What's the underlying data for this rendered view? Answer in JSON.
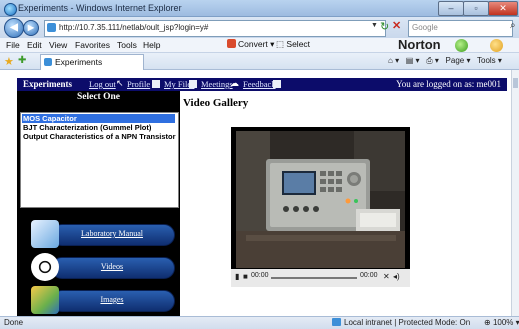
{
  "window": {
    "title": "Experiments - Windows Internet Explorer",
    "min": "–",
    "max": "▫",
    "close": "✕"
  },
  "address": {
    "url": "http://10.7.35.111/netlab/oult_jsp?login=y#",
    "search_placeholder": "Google"
  },
  "menu": {
    "file": "File",
    "edit": "Edit",
    "view": "View",
    "favorites": "Favorites",
    "tools": "Tools",
    "help": "Help",
    "convert": "Convert",
    "select": "Select",
    "norton": "Norton"
  },
  "favbar": {
    "tab_label": "Experiments",
    "page": "Page",
    "tools": "Tools"
  },
  "nav": {
    "experiments": "Experiments",
    "logout": "Log out",
    "profile": "Profile",
    "myfiles": "My Files",
    "meetings": "Meetings",
    "feedback": "Feedback",
    "logged_in": "You are logged on as: me001"
  },
  "left": {
    "heading": "Select One",
    "experiments": [
      "MOS Capacitor",
      "BJT Characterization (Gummel Plot)",
      "Output Characteristics of a NPN Transistor"
    ],
    "selected_index": 0,
    "buttons": [
      "Laboratory Manual",
      "Videos",
      "Images"
    ]
  },
  "gallery": {
    "title": "Video Gallery",
    "time_elapsed": "00:00",
    "time_total": "00:00"
  },
  "status": {
    "left": "Done",
    "zone": "Local intranet | Protected Mode: On",
    "zoom": "100%"
  },
  "colors": {
    "nav_bg": "#0c0c6a",
    "panel_bg": "#000000",
    "selection": "#2f6fe0"
  }
}
